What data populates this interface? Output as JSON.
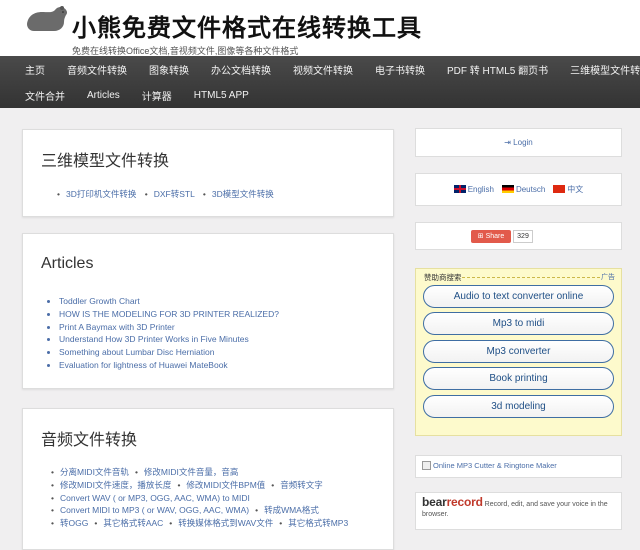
{
  "header": {
    "title": "小熊免费文件格式在线转换工具",
    "subtitle": "免费在线转换Office文档,音视频文件,图像等各种文件格式"
  },
  "nav": {
    "row1": [
      "主页",
      "音频文件转换",
      "图象转换",
      "办公文档转换",
      "视频文件转换",
      "电子书转换",
      "PDF 转 HTML5 翻页书",
      "三维模型文件转换"
    ],
    "row2": [
      "文件合并",
      "Articles",
      "计算器",
      "HTML5 APP"
    ]
  },
  "cards": {
    "model": {
      "title": "三维模型文件转换",
      "items": [
        "3D打印机文件转换",
        "DXF转STL",
        "3D模型文件转换"
      ]
    },
    "articles": {
      "title": "Articles",
      "items": [
        "Toddler Growth Chart",
        "HOW IS THE MODELING FOR 3D PRINTER REALIZED?",
        "Print A Baymax with 3D Printer",
        "Understand How 3D Printer Works in Five Minutes",
        "Something about Lumbar Disc Herniation",
        "Evaluation for lightness of Huawei MateBook"
      ]
    },
    "audio": {
      "title": "音频文件转换",
      "lines": [
        [
          "分离MIDI文件音轨",
          "修改MIDI文件音量，音高"
        ],
        [
          "修改MIDI文件速度，播放长度",
          "修改MIDI文件BPM值",
          "音频转文字"
        ],
        [
          "Convert WAV ( or MP3, OGG, AAC, WMA) to MIDI"
        ],
        [
          "Convert MIDI to MP3 ( or WAV, OGG, AAC, WMA)",
          "转成WMA格式"
        ],
        [
          "转OGG",
          "其它格式转AAC",
          "转换媒体格式到WAV文件",
          "其它格式转MP3"
        ]
      ]
    }
  },
  "sidebar": {
    "login": "Login",
    "languages": [
      "English",
      "Deutsch",
      "中文"
    ],
    "share_label": "Share",
    "share_count": "329",
    "ads_title": "赞助商搜索",
    "ads_badge": "广告",
    "ads": [
      "Audio to text converter online",
      "Mp3 to midi",
      "Mp3 converter",
      "Book printing",
      "3d modeling"
    ],
    "mp3_link": "Online MP3 Cutter & Ringtone Maker",
    "bear_logo_a": "bear",
    "bear_logo_b": "record",
    "bear_desc": "Record, edit, and save your voice in the browser."
  },
  "colors": {
    "nav_bg": "#3d3d3d",
    "link": "#4b6ea8",
    "share": "#e25a4b",
    "ad_bg": "#fdfacc"
  }
}
